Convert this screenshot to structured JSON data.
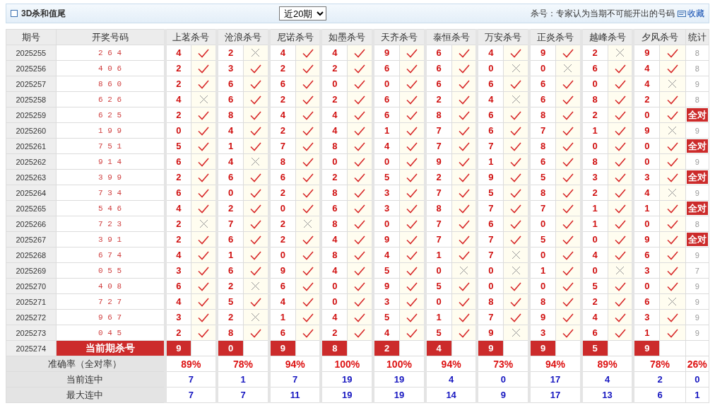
{
  "header": {
    "title": "3D杀和值尾",
    "period_select": "近20期",
    "note": "杀号：专家认为当期不可能开出的号码",
    "link": "收藏"
  },
  "table": {
    "columns": {
      "issue": "期号",
      "draw": "开奖号码",
      "experts": [
        "上茗杀号",
        "沧浪杀号",
        "尼诺杀号",
        "如墨杀号",
        "天齐杀号",
        "泰恒杀号",
        "万安杀号",
        "正炎杀号",
        "越峰杀号",
        "夕风杀号"
      ],
      "tally": "统计"
    },
    "rows": [
      {
        "issue": "2025255",
        "draw": "2 6 4",
        "picks": [
          {
            "number": "4",
            "hit": true
          },
          {
            "number": "2",
            "hit": false
          },
          {
            "number": "4",
            "hit": true
          },
          {
            "number": "4",
            "hit": true
          },
          {
            "number": "9",
            "hit": true
          },
          {
            "number": "6",
            "hit": true
          },
          {
            "number": "4",
            "hit": true
          },
          {
            "number": "9",
            "hit": true
          },
          {
            "number": "2",
            "hit": false
          },
          {
            "number": "9",
            "hit": true
          }
        ],
        "tally": {
          "kind": "count",
          "text": "8"
        }
      },
      {
        "issue": "2025256",
        "draw": "4 0 6",
        "picks": [
          {
            "number": "2",
            "hit": true
          },
          {
            "number": "3",
            "hit": true
          },
          {
            "number": "2",
            "hit": true
          },
          {
            "number": "2",
            "hit": true
          },
          {
            "number": "6",
            "hit": true
          },
          {
            "number": "6",
            "hit": true
          },
          {
            "number": "0",
            "hit": false
          },
          {
            "number": "0",
            "hit": false
          },
          {
            "number": "6",
            "hit": true
          },
          {
            "number": "4",
            "hit": true
          }
        ],
        "tally": {
          "kind": "count",
          "text": "8"
        }
      },
      {
        "issue": "2025257",
        "draw": "8 6 0",
        "picks": [
          {
            "number": "2",
            "hit": true
          },
          {
            "number": "6",
            "hit": true
          },
          {
            "number": "6",
            "hit": true
          },
          {
            "number": "0",
            "hit": true
          },
          {
            "number": "0",
            "hit": true
          },
          {
            "number": "6",
            "hit": true
          },
          {
            "number": "6",
            "hit": true
          },
          {
            "number": "6",
            "hit": true
          },
          {
            "number": "0",
            "hit": true
          },
          {
            "number": "4",
            "hit": false
          }
        ],
        "tally": {
          "kind": "count",
          "text": "9"
        }
      },
      {
        "issue": "2025258",
        "draw": "6 2 6",
        "picks": [
          {
            "number": "4",
            "hit": false
          },
          {
            "number": "6",
            "hit": true
          },
          {
            "number": "2",
            "hit": true
          },
          {
            "number": "2",
            "hit": true
          },
          {
            "number": "6",
            "hit": true
          },
          {
            "number": "2",
            "hit": true
          },
          {
            "number": "4",
            "hit": false
          },
          {
            "number": "6",
            "hit": true
          },
          {
            "number": "8",
            "hit": true
          },
          {
            "number": "2",
            "hit": true
          }
        ],
        "tally": {
          "kind": "count",
          "text": "8"
        }
      },
      {
        "issue": "2025259",
        "draw": "6 2 5",
        "picks": [
          {
            "number": "2",
            "hit": true
          },
          {
            "number": "8",
            "hit": true
          },
          {
            "number": "4",
            "hit": true
          },
          {
            "number": "4",
            "hit": true
          },
          {
            "number": "6",
            "hit": true
          },
          {
            "number": "8",
            "hit": true
          },
          {
            "number": "6",
            "hit": true
          },
          {
            "number": "8",
            "hit": true
          },
          {
            "number": "2",
            "hit": true
          },
          {
            "number": "0",
            "hit": true
          }
        ],
        "tally": {
          "kind": "badge",
          "text": "全对"
        }
      },
      {
        "issue": "2025260",
        "draw": "1 9 9",
        "picks": [
          {
            "number": "0",
            "hit": true
          },
          {
            "number": "4",
            "hit": true
          },
          {
            "number": "2",
            "hit": true
          },
          {
            "number": "4",
            "hit": true
          },
          {
            "number": "1",
            "hit": true
          },
          {
            "number": "7",
            "hit": true
          },
          {
            "number": "6",
            "hit": true
          },
          {
            "number": "7",
            "hit": true
          },
          {
            "number": "1",
            "hit": true
          },
          {
            "number": "9",
            "hit": false
          }
        ],
        "tally": {
          "kind": "count",
          "text": "9"
        }
      },
      {
        "issue": "2025261",
        "draw": "7 5 1",
        "picks": [
          {
            "number": "5",
            "hit": true
          },
          {
            "number": "1",
            "hit": true
          },
          {
            "number": "7",
            "hit": true
          },
          {
            "number": "8",
            "hit": true
          },
          {
            "number": "4",
            "hit": true
          },
          {
            "number": "7",
            "hit": true
          },
          {
            "number": "7",
            "hit": true
          },
          {
            "number": "8",
            "hit": true
          },
          {
            "number": "0",
            "hit": true
          },
          {
            "number": "0",
            "hit": true
          }
        ],
        "tally": {
          "kind": "badge",
          "text": "全对"
        }
      },
      {
        "issue": "2025262",
        "draw": "9 1 4",
        "picks": [
          {
            "number": "6",
            "hit": true
          },
          {
            "number": "4",
            "hit": false
          },
          {
            "number": "8",
            "hit": true
          },
          {
            "number": "0",
            "hit": true
          },
          {
            "number": "0",
            "hit": true
          },
          {
            "number": "9",
            "hit": true
          },
          {
            "number": "1",
            "hit": true
          },
          {
            "number": "6",
            "hit": true
          },
          {
            "number": "8",
            "hit": true
          },
          {
            "number": "0",
            "hit": true
          }
        ],
        "tally": {
          "kind": "count",
          "text": "9"
        }
      },
      {
        "issue": "2025263",
        "draw": "3 9 9",
        "picks": [
          {
            "number": "2",
            "hit": true
          },
          {
            "number": "6",
            "hit": true
          },
          {
            "number": "6",
            "hit": true
          },
          {
            "number": "2",
            "hit": true
          },
          {
            "number": "5",
            "hit": true
          },
          {
            "number": "2",
            "hit": true
          },
          {
            "number": "9",
            "hit": true
          },
          {
            "number": "5",
            "hit": true
          },
          {
            "number": "3",
            "hit": true
          },
          {
            "number": "3",
            "hit": true
          }
        ],
        "tally": {
          "kind": "badge",
          "text": "全对"
        }
      },
      {
        "issue": "2025264",
        "draw": "7 3 4",
        "picks": [
          {
            "number": "6",
            "hit": true
          },
          {
            "number": "0",
            "hit": true
          },
          {
            "number": "2",
            "hit": true
          },
          {
            "number": "8",
            "hit": true
          },
          {
            "number": "3",
            "hit": true
          },
          {
            "number": "7",
            "hit": true
          },
          {
            "number": "5",
            "hit": true
          },
          {
            "number": "8",
            "hit": true
          },
          {
            "number": "2",
            "hit": true
          },
          {
            "number": "4",
            "hit": false
          }
        ],
        "tally": {
          "kind": "count",
          "text": "9"
        }
      },
      {
        "issue": "2025265",
        "draw": "5 4 6",
        "picks": [
          {
            "number": "4",
            "hit": true
          },
          {
            "number": "2",
            "hit": true
          },
          {
            "number": "0",
            "hit": true
          },
          {
            "number": "6",
            "hit": true
          },
          {
            "number": "3",
            "hit": true
          },
          {
            "number": "8",
            "hit": true
          },
          {
            "number": "7",
            "hit": true
          },
          {
            "number": "7",
            "hit": true
          },
          {
            "number": "1",
            "hit": true
          },
          {
            "number": "1",
            "hit": true
          }
        ],
        "tally": {
          "kind": "badge",
          "text": "全对"
        }
      },
      {
        "issue": "2025266",
        "draw": "7 2 3",
        "picks": [
          {
            "number": "2",
            "hit": false
          },
          {
            "number": "7",
            "hit": true
          },
          {
            "number": "2",
            "hit": false
          },
          {
            "number": "8",
            "hit": true
          },
          {
            "number": "0",
            "hit": true
          },
          {
            "number": "7",
            "hit": true
          },
          {
            "number": "6",
            "hit": true
          },
          {
            "number": "0",
            "hit": true
          },
          {
            "number": "1",
            "hit": true
          },
          {
            "number": "0",
            "hit": true
          }
        ],
        "tally": {
          "kind": "count",
          "text": "8"
        }
      },
      {
        "issue": "2025267",
        "draw": "3 9 1",
        "picks": [
          {
            "number": "2",
            "hit": true
          },
          {
            "number": "6",
            "hit": true
          },
          {
            "number": "2",
            "hit": true
          },
          {
            "number": "4",
            "hit": true
          },
          {
            "number": "9",
            "hit": true
          },
          {
            "number": "7",
            "hit": true
          },
          {
            "number": "7",
            "hit": true
          },
          {
            "number": "5",
            "hit": true
          },
          {
            "number": "0",
            "hit": true
          },
          {
            "number": "9",
            "hit": true
          }
        ],
        "tally": {
          "kind": "badge",
          "text": "全对"
        }
      },
      {
        "issue": "2025268",
        "draw": "6 7 4",
        "picks": [
          {
            "number": "4",
            "hit": true
          },
          {
            "number": "1",
            "hit": true
          },
          {
            "number": "0",
            "hit": true
          },
          {
            "number": "8",
            "hit": true
          },
          {
            "number": "4",
            "hit": true
          },
          {
            "number": "1",
            "hit": true
          },
          {
            "number": "7",
            "hit": false
          },
          {
            "number": "0",
            "hit": true
          },
          {
            "number": "4",
            "hit": true
          },
          {
            "number": "6",
            "hit": true
          }
        ],
        "tally": {
          "kind": "count",
          "text": "9"
        }
      },
      {
        "issue": "2025269",
        "draw": "0 5 5",
        "picks": [
          {
            "number": "3",
            "hit": true
          },
          {
            "number": "6",
            "hit": true
          },
          {
            "number": "9",
            "hit": true
          },
          {
            "number": "4",
            "hit": true
          },
          {
            "number": "5",
            "hit": true
          },
          {
            "number": "0",
            "hit": false
          },
          {
            "number": "0",
            "hit": false
          },
          {
            "number": "1",
            "hit": true
          },
          {
            "number": "0",
            "hit": false
          },
          {
            "number": "3",
            "hit": true
          }
        ],
        "tally": {
          "kind": "count",
          "text": "7"
        }
      },
      {
        "issue": "2025270",
        "draw": "4 0 8",
        "picks": [
          {
            "number": "6",
            "hit": true
          },
          {
            "number": "2",
            "hit": false
          },
          {
            "number": "6",
            "hit": true
          },
          {
            "number": "0",
            "hit": true
          },
          {
            "number": "9",
            "hit": true
          },
          {
            "number": "5",
            "hit": true
          },
          {
            "number": "0",
            "hit": true
          },
          {
            "number": "0",
            "hit": true
          },
          {
            "number": "5",
            "hit": true
          },
          {
            "number": "0",
            "hit": true
          }
        ],
        "tally": {
          "kind": "count",
          "text": "9"
        }
      },
      {
        "issue": "2025271",
        "draw": "7 2 7",
        "picks": [
          {
            "number": "4",
            "hit": true
          },
          {
            "number": "5",
            "hit": true
          },
          {
            "number": "4",
            "hit": true
          },
          {
            "number": "0",
            "hit": true
          },
          {
            "number": "3",
            "hit": true
          },
          {
            "number": "0",
            "hit": true
          },
          {
            "number": "8",
            "hit": true
          },
          {
            "number": "8",
            "hit": true
          },
          {
            "number": "2",
            "hit": true
          },
          {
            "number": "6",
            "hit": false
          }
        ],
        "tally": {
          "kind": "count",
          "text": "9"
        }
      },
      {
        "issue": "2025272",
        "draw": "9 6 7",
        "picks": [
          {
            "number": "3",
            "hit": true
          },
          {
            "number": "2",
            "hit": false
          },
          {
            "number": "1",
            "hit": true
          },
          {
            "number": "4",
            "hit": true
          },
          {
            "number": "5",
            "hit": true
          },
          {
            "number": "1",
            "hit": true
          },
          {
            "number": "7",
            "hit": true
          },
          {
            "number": "9",
            "hit": true
          },
          {
            "number": "4",
            "hit": true
          },
          {
            "number": "3",
            "hit": true
          }
        ],
        "tally": {
          "kind": "count",
          "text": "9"
        }
      },
      {
        "issue": "2025273",
        "draw": "0 4 5",
        "picks": [
          {
            "number": "2",
            "hit": true
          },
          {
            "number": "8",
            "hit": true
          },
          {
            "number": "6",
            "hit": true
          },
          {
            "number": "2",
            "hit": true
          },
          {
            "number": "4",
            "hit": true
          },
          {
            "number": "5",
            "hit": true
          },
          {
            "number": "9",
            "hit": false
          },
          {
            "number": "3",
            "hit": true
          },
          {
            "number": "6",
            "hit": true
          },
          {
            "number": "1",
            "hit": true
          }
        ],
        "tally": {
          "kind": "count",
          "text": "9"
        }
      }
    ],
    "current": {
      "issue": "2025274",
      "label": "当前期杀号",
      "numbers": [
        "9",
        "0",
        "9",
        "8",
        "2",
        "4",
        "9",
        "9",
        "5",
        "9"
      ]
    },
    "summary": [
      {
        "label": "准确率（全对率）",
        "kind": "rate",
        "values": [
          "89%",
          "78%",
          "94%",
          "100%",
          "100%",
          "94%",
          "73%",
          "94%",
          "89%",
          "78%",
          "26%"
        ]
      },
      {
        "label": "当前连中",
        "kind": "streak",
        "values": [
          "7",
          "1",
          "7",
          "19",
          "19",
          "4",
          "0",
          "17",
          "4",
          "2",
          "0"
        ]
      },
      {
        "label": "最大连中",
        "kind": "streak",
        "values": [
          "7",
          "7",
          "11",
          "19",
          "19",
          "14",
          "9",
          "17",
          "13",
          "6",
          "1"
        ]
      }
    ]
  }
}
